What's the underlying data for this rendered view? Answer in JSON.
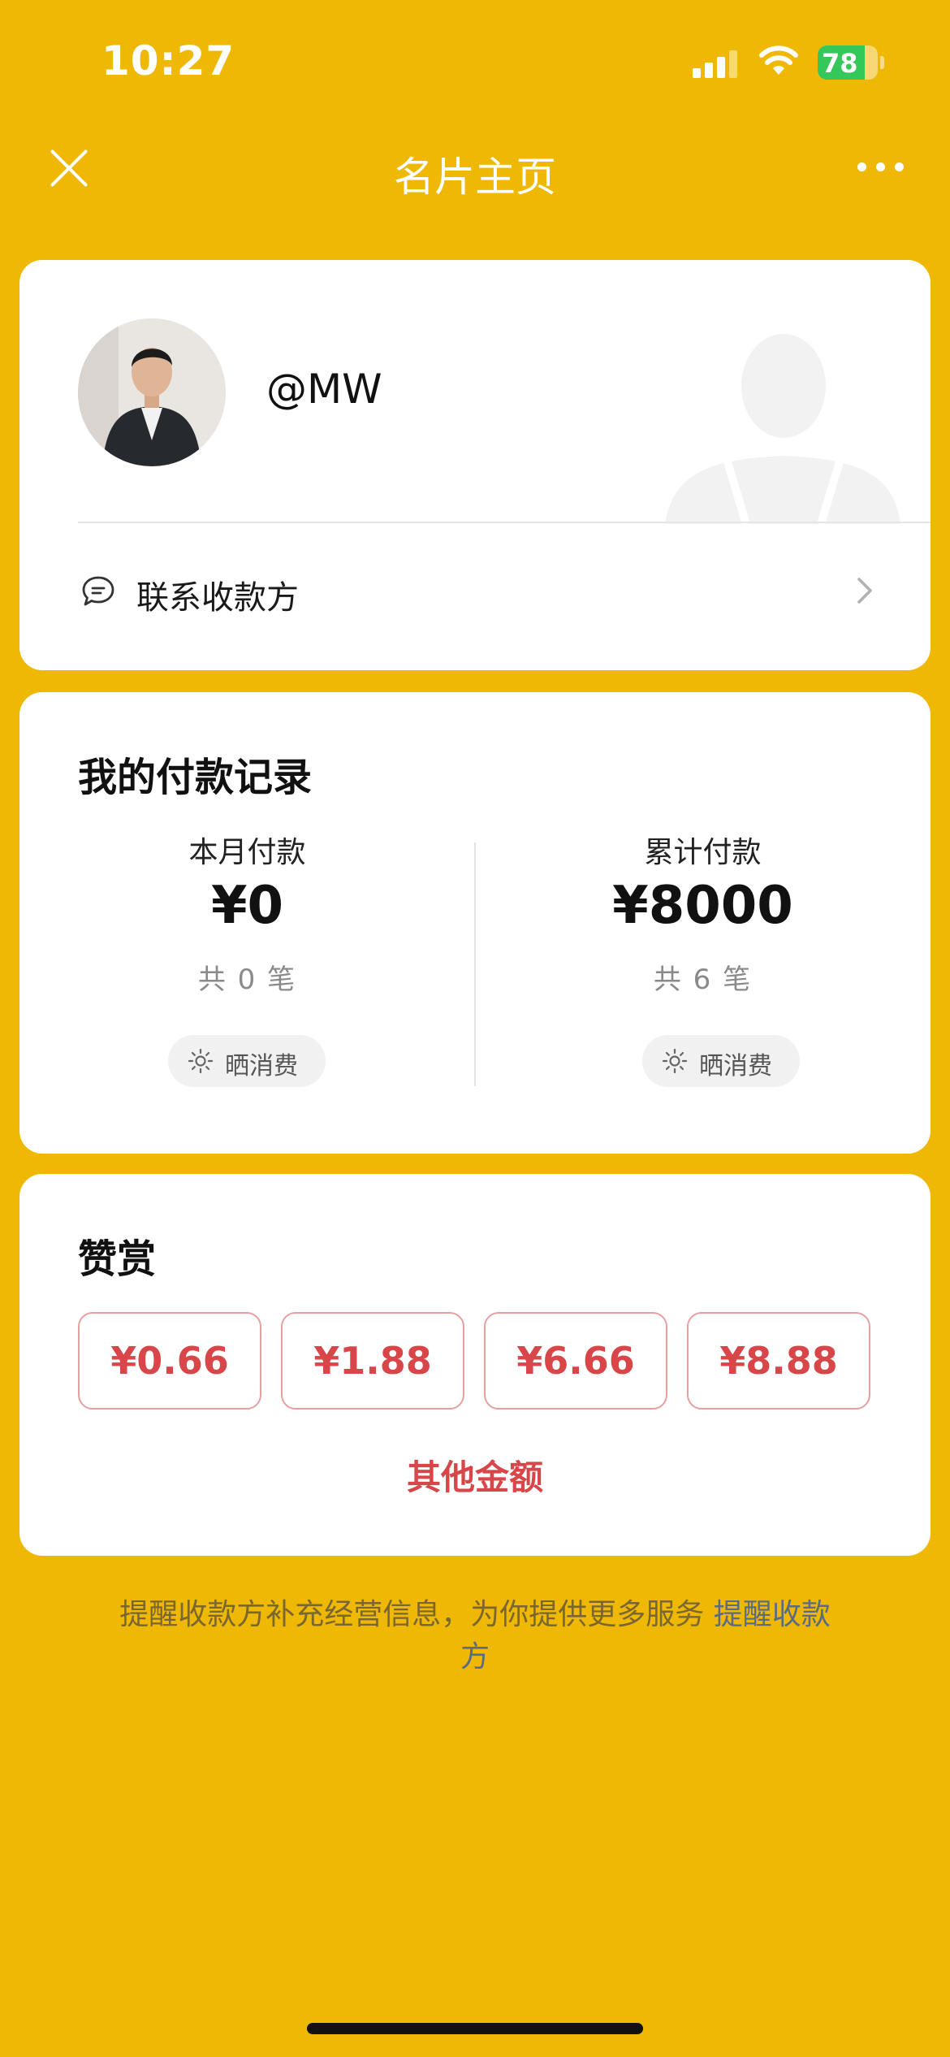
{
  "status": {
    "time": "10:27",
    "battery": "78"
  },
  "nav": {
    "title": "名片主页"
  },
  "profile": {
    "username": "@MW",
    "contact_label": "联系收款方"
  },
  "records": {
    "title": "我的付款记录",
    "this_month": {
      "label": "本月付款",
      "amount": "¥0",
      "count": "共 0 笔",
      "show_label": "晒消费"
    },
    "total": {
      "label": "累计付款",
      "amount": "¥8000",
      "count": "共 6 笔",
      "show_label": "晒消费"
    }
  },
  "reward": {
    "title": "赞赏",
    "amounts": [
      "¥0.66",
      "¥1.88",
      "¥6.66",
      "¥8.88"
    ],
    "other_label": "其他金额"
  },
  "footer": {
    "text": "提醒收款方补充经营信息，为你提供更多服务 ",
    "link": "提醒收款方"
  },
  "colors": {
    "background": "#EEB805",
    "accent_red": "#D9464A",
    "battery_green": "#34C759"
  }
}
